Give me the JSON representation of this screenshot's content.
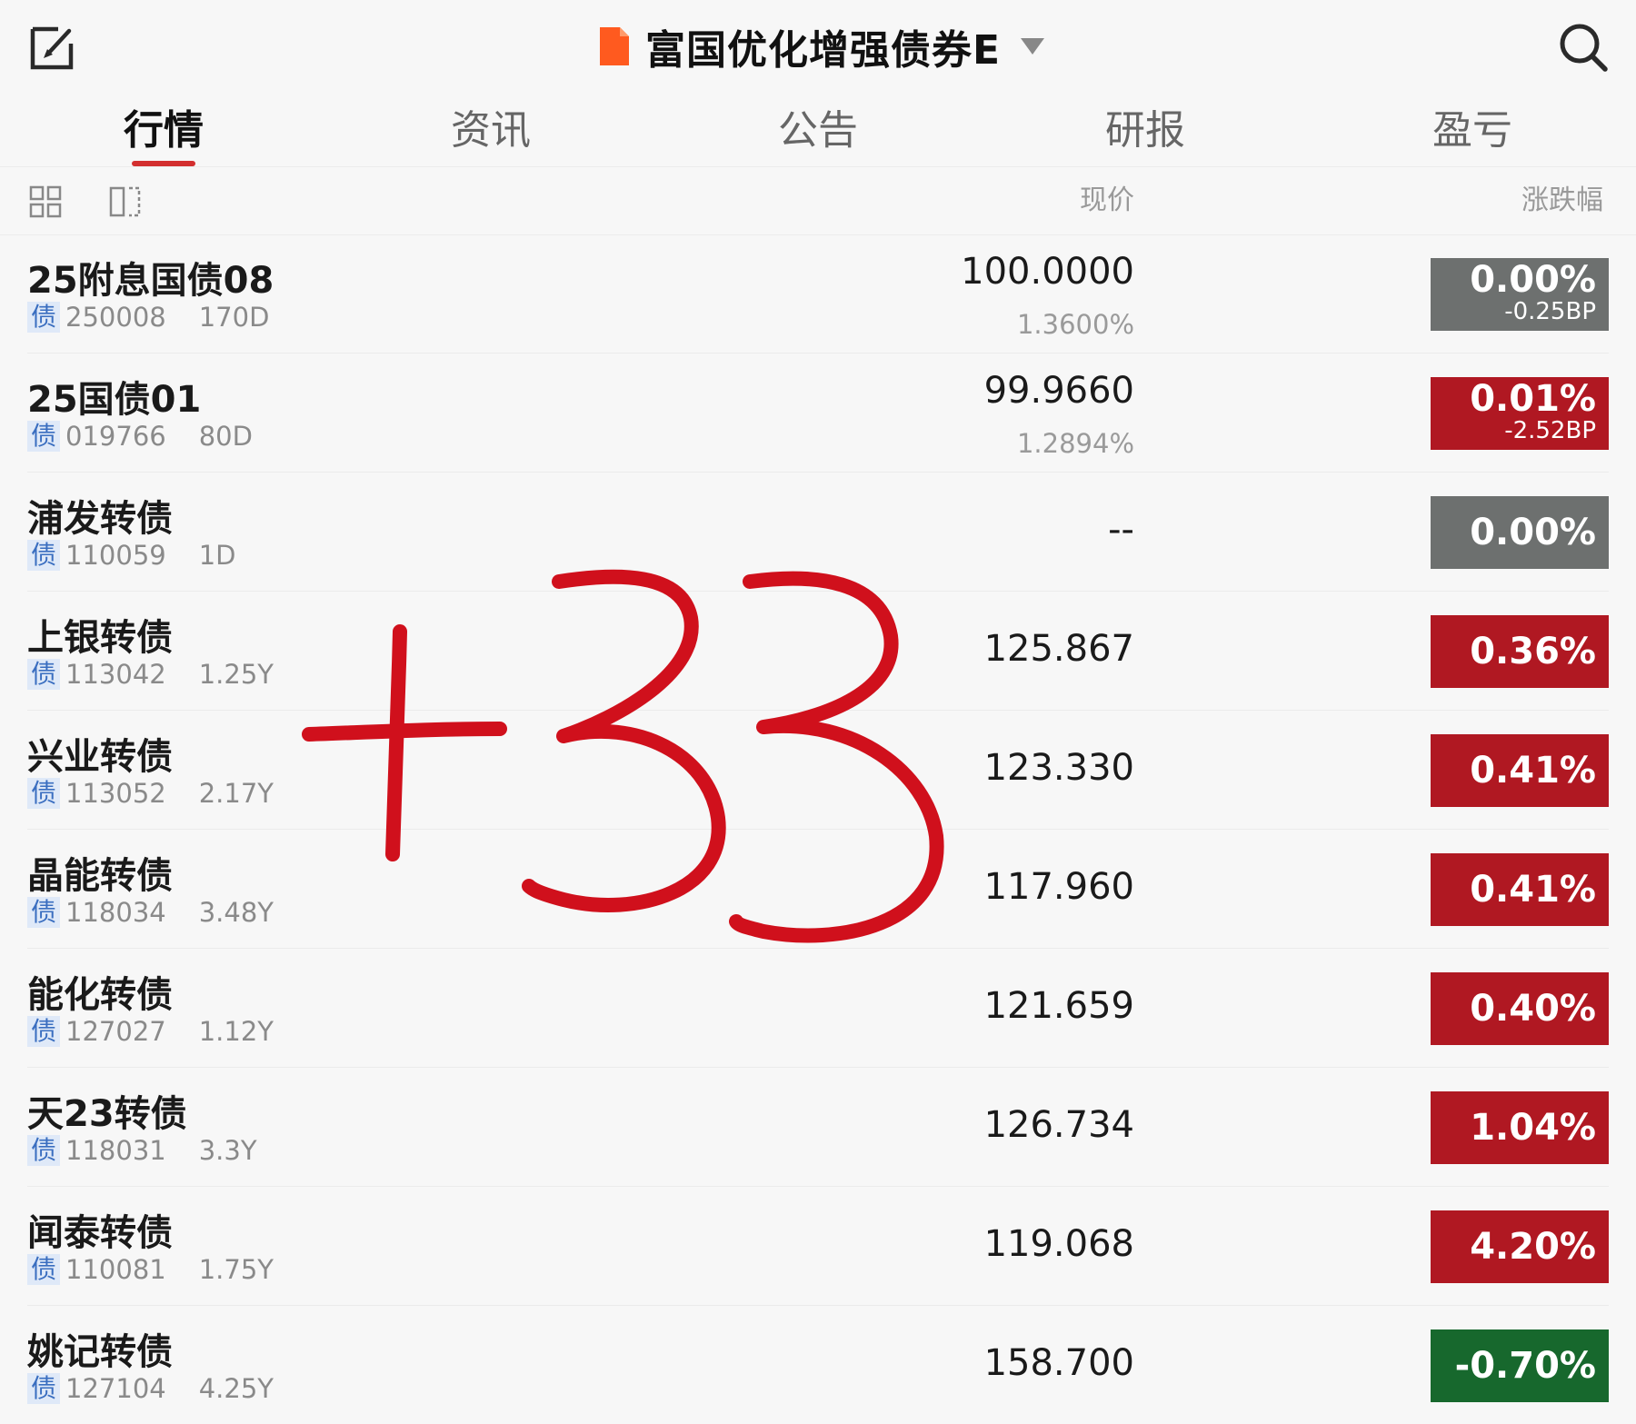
{
  "header": {
    "fund_title": "富国优化增强债券E",
    "icons": {
      "left": "edit-icon",
      "right": "search-icon",
      "flag": "flag-icon",
      "dropdown": "chevron-down-icon"
    },
    "flag_color": "#ff5a1f"
  },
  "tabs": [
    {
      "label": "行情",
      "active": true
    },
    {
      "label": "资讯",
      "active": false
    },
    {
      "label": "公告",
      "active": false
    },
    {
      "label": "研报",
      "active": false
    },
    {
      "label": "盈亏",
      "active": false
    }
  ],
  "columns": {
    "price": "现价",
    "change": "涨跌幅"
  },
  "tag_label": "债",
  "rows": [
    {
      "name": "25附息国债08",
      "code": "250008",
      "term": "170D",
      "price": "100.0000",
      "yield": "1.3600%",
      "change": "0.00%",
      "change_sub": "-0.25BP",
      "color": "gray"
    },
    {
      "name": "25国债01",
      "code": "019766",
      "term": "80D",
      "price": "99.9660",
      "yield": "1.2894%",
      "change": "0.01%",
      "change_sub": "-2.52BP",
      "color": "red"
    },
    {
      "name": "浦发转债",
      "code": "110059",
      "term": "1D",
      "price": "--",
      "yield": "",
      "change": "0.00%",
      "change_sub": "",
      "color": "gray"
    },
    {
      "name": "上银转债",
      "code": "113042",
      "term": "1.25Y",
      "price": "125.867",
      "yield": "",
      "change": "0.36%",
      "change_sub": "",
      "color": "red"
    },
    {
      "name": "兴业转债",
      "code": "113052",
      "term": "2.17Y",
      "price": "123.330",
      "yield": "",
      "change": "0.41%",
      "change_sub": "",
      "color": "red"
    },
    {
      "name": "晶能转债",
      "code": "118034",
      "term": "3.48Y",
      "price": "117.960",
      "yield": "",
      "change": "0.41%",
      "change_sub": "",
      "color": "red"
    },
    {
      "name": "能化转债",
      "code": "127027",
      "term": "1.12Y",
      "price": "121.659",
      "yield": "",
      "change": "0.40%",
      "change_sub": "",
      "color": "red"
    },
    {
      "name": "天23转债",
      "code": "118031",
      "term": "3.3Y",
      "price": "126.734",
      "yield": "",
      "change": "1.04%",
      "change_sub": "",
      "color": "red"
    },
    {
      "name": "闻泰转债",
      "code": "110081",
      "term": "1.75Y",
      "price": "119.068",
      "yield": "",
      "change": "4.20%",
      "change_sub": "",
      "color": "red"
    },
    {
      "name": "姚记转债",
      "code": "127104",
      "term": "4.25Y",
      "price": "158.700",
      "yield": "",
      "change": "-0.70%",
      "change_sub": "",
      "color": "green"
    }
  ],
  "annotation": {
    "text": "+33",
    "color": "#d0101c"
  }
}
